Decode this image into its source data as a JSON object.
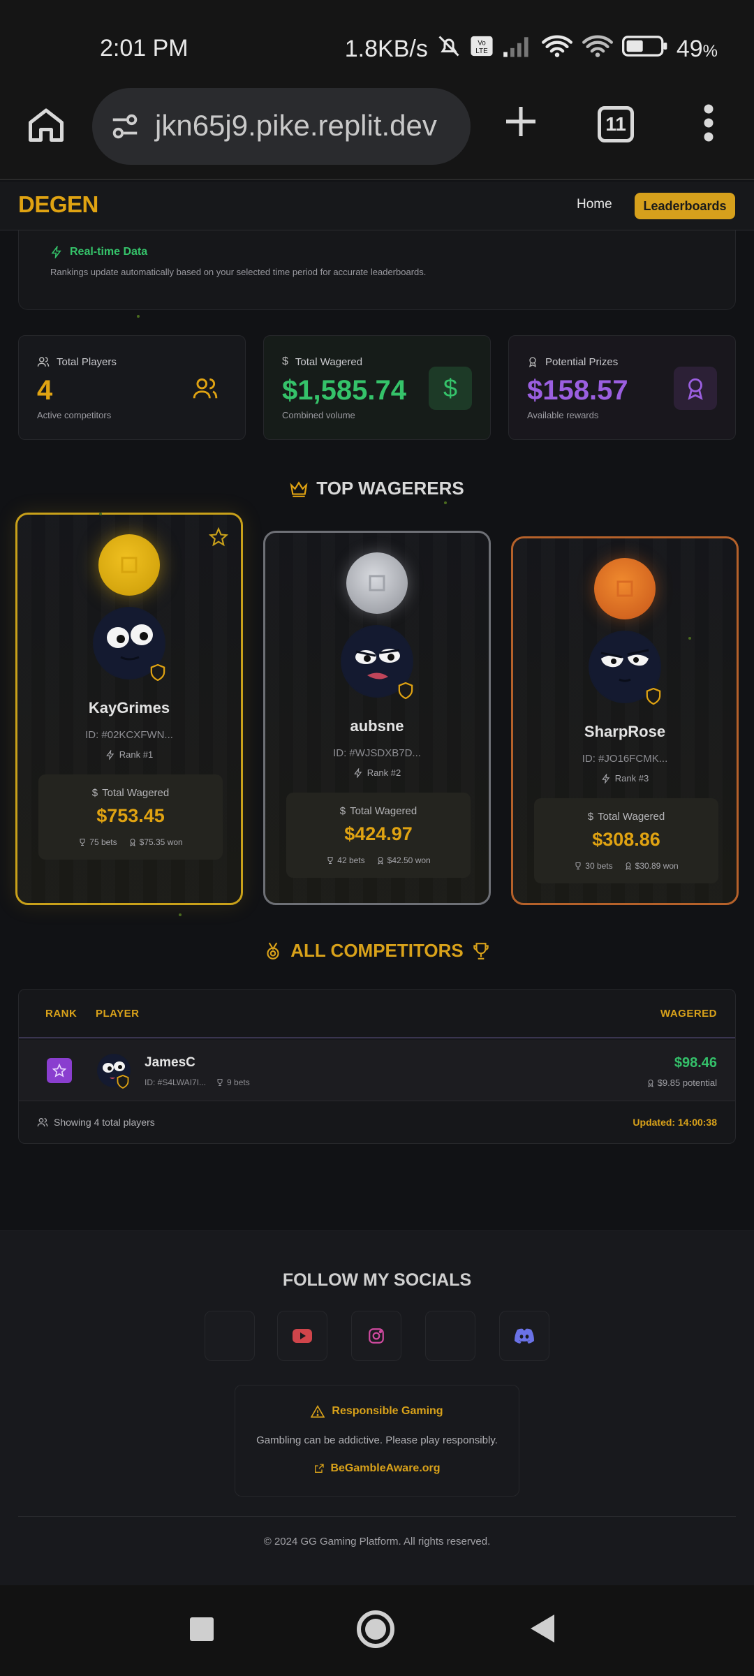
{
  "status_bar": {
    "time": "2:01 PM",
    "net_speed": "1.8KB/s",
    "battery": "49",
    "battery_unit": "%"
  },
  "browser": {
    "url": "jkn65j9.pike.replit.dev",
    "tab_count": "11"
  },
  "site_header": {
    "logo": "DEGEN",
    "nav_home": "Home",
    "nav_leaderboards": "Leaderboards"
  },
  "realtime": {
    "title": "Real-time Data",
    "description": "Rankings update automatically based on your selected time period for accurate leaderboards."
  },
  "stats": [
    {
      "label": "Total Players",
      "value": "4",
      "sub": "Active competitors",
      "icon": "users-icon",
      "color": "#e0a312"
    },
    {
      "label": "Total Wagered",
      "value": "$1,585.74",
      "sub": "Combined volume",
      "icon": "dollar-icon",
      "color": "#35c36a"
    },
    {
      "label": "Potential Prizes",
      "value": "$158.57",
      "sub": "Available rewards",
      "icon": "award-icon",
      "color": "#9b5fe0"
    }
  ],
  "top_wagerers": {
    "title": "TOP WAGERERS",
    "players": [
      {
        "name": "KayGrimes",
        "id": "ID: #02KCXFWN...",
        "rank": "Rank #1",
        "total_label": "Total Wagered",
        "total": "$753.45",
        "bets": "75 bets",
        "won": "$75.35 won",
        "accent": "#c9a11a"
      },
      {
        "name": "aubsne",
        "id": "ID: #WJSDXB7D...",
        "rank": "Rank #2",
        "total_label": "Total Wagered",
        "total": "$424.97",
        "bets": "42 bets",
        "won": "$42.50 won",
        "accent": "#8e9096"
      },
      {
        "name": "SharpRose",
        "id": "ID: #JO16FCMK...",
        "rank": "Rank #3",
        "total_label": "Total Wagered",
        "total": "$308.86",
        "bets": "30 bets",
        "won": "$30.89 won",
        "accent": "#c76a2a"
      }
    ]
  },
  "all_competitors": {
    "title": "ALL COMPETITORS",
    "columns": {
      "rank": "RANK",
      "player": "PLAYER",
      "wagered": "WAGERED"
    },
    "rows": [
      {
        "name": "JamesC",
        "id": "ID: #S4LWAI7I...",
        "bets": "9 bets",
        "wagered": "$98.46",
        "potential": "$9.85 potential"
      }
    ],
    "footer_left": "Showing 4 total players",
    "footer_right": "Updated: 14:00:38"
  },
  "footer": {
    "socials_title": "FOLLOW MY SOCIALS",
    "socials": [
      "blank",
      "youtube-icon",
      "instagram-icon",
      "blank",
      "discord-icon"
    ],
    "rg_title": "Responsible Gaming",
    "rg_text": "Gambling can be addictive. Please play responsibly.",
    "rg_link": "BeGambleAware.org",
    "copyright": "© 2024 GG Gaming Platform. All rights reserved."
  }
}
